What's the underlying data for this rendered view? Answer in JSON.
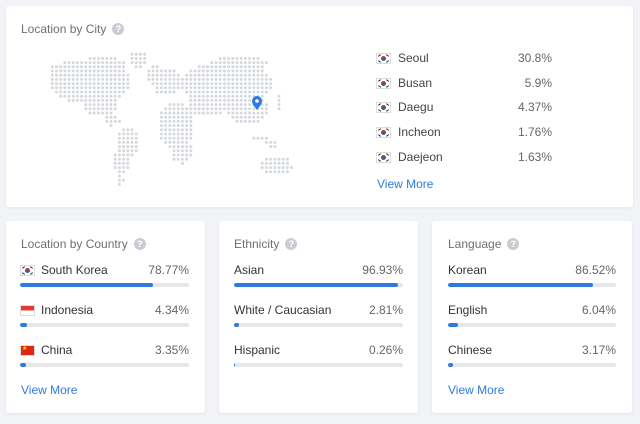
{
  "city_card": {
    "title": "Location by City",
    "help": "?",
    "cities": [
      {
        "name": "Seoul",
        "pct": "30.8%"
      },
      {
        "name": "Busan",
        "pct": "5.9%"
      },
      {
        "name": "Daegu",
        "pct": "4.37%"
      },
      {
        "name": "Incheon",
        "pct": "1.76%"
      },
      {
        "name": "Daejeon",
        "pct": "1.63%"
      }
    ],
    "view_more": "View More"
  },
  "country_card": {
    "title": "Location by Country",
    "help": "?",
    "rows": [
      {
        "label": "South Korea",
        "pct": "78.77%",
        "flag": "kr",
        "fraction": 0.7877
      },
      {
        "label": "Indonesia",
        "pct": "4.34%",
        "flag": "id",
        "fraction": 0.0434
      },
      {
        "label": "China",
        "pct": "3.35%",
        "flag": "cn",
        "fraction": 0.0335
      }
    ],
    "view_more": "View More"
  },
  "ethnicity_card": {
    "title": "Ethnicity",
    "help": "?",
    "rows": [
      {
        "label": "Asian",
        "pct": "96.93%",
        "fraction": 0.9693
      },
      {
        "label": "White / Caucasian",
        "pct": "2.81%",
        "fraction": 0.0281
      },
      {
        "label": "Hispanic",
        "pct": "0.26%",
        "fraction": 0.0026
      }
    ]
  },
  "language_card": {
    "title": "Language",
    "help": "?",
    "rows": [
      {
        "label": "Korean",
        "pct": "86.52%",
        "fraction": 0.8652
      },
      {
        "label": "English",
        "pct": "6.04%",
        "fraction": 0.0604
      },
      {
        "label": "Chinese",
        "pct": "3.17%",
        "fraction": 0.0317
      }
    ],
    "view_more": "View More"
  },
  "colors": {
    "accent": "#2e7be0",
    "track": "#e5e7ea",
    "map_dot": "#d5d8dc"
  },
  "icons": [
    "help-icon",
    "map-pin-icon",
    "flag-south-korea-icon",
    "flag-indonesia-icon",
    "flag-china-icon"
  ]
}
